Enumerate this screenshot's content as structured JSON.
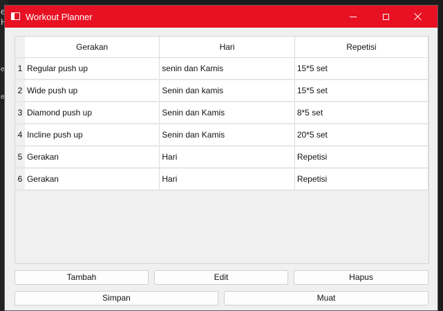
{
  "background": {
    "chars": [
      "e",
      "H",
      "e",
      "e"
    ]
  },
  "window": {
    "title": "Workout Planner",
    "controls": [
      "minimize",
      "maximize",
      "close"
    ],
    "accent": "#e81123"
  },
  "table": {
    "headers": [
      "Gerakan",
      "Hari",
      "Repetisi"
    ],
    "rows": [
      {
        "num": "1",
        "cells": [
          "Regular push up",
          "senin dan Kamis",
          "15*5 set"
        ]
      },
      {
        "num": "2",
        "cells": [
          "Wide push up",
          "Senin dan kamis",
          "15*5 set"
        ]
      },
      {
        "num": "3",
        "cells": [
          "Diamond push up",
          "Senin dan Kamis",
          "8*5 set"
        ]
      },
      {
        "num": "4",
        "cells": [
          "Incline push up",
          "Senin dan Kamis",
          "20*5 set"
        ]
      },
      {
        "num": "5",
        "cells": [
          "Gerakan",
          "Hari",
          "Repetisi"
        ]
      },
      {
        "num": "6",
        "cells": [
          "Gerakan",
          "Hari",
          "Repetisi"
        ]
      }
    ]
  },
  "buttons": {
    "tambah": "Tambah",
    "edit": "Edit",
    "hapus": "Hapus",
    "simpan": "Simpan",
    "muat": "Muat"
  }
}
